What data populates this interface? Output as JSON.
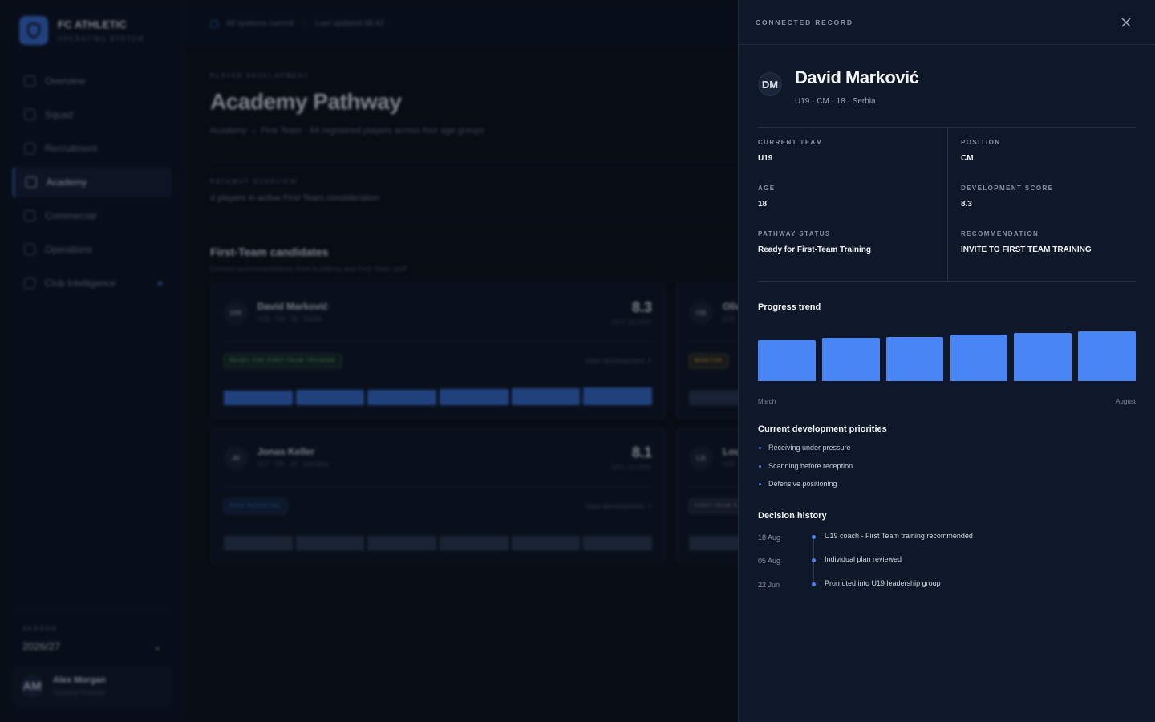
{
  "brand": {
    "name": "FC ATHLETIC",
    "subtitle": "OPERATING SYSTEM"
  },
  "nav": [
    {
      "label": "Overview",
      "icon": "grid-icon",
      "active": false
    },
    {
      "label": "Squad",
      "icon": "users-icon",
      "active": false
    },
    {
      "label": "Recruitment",
      "icon": "globe-icon",
      "active": false
    },
    {
      "label": "Academy",
      "icon": "graduation-cap-icon",
      "active": true
    },
    {
      "label": "Commercial",
      "icon": "briefcase-icon",
      "active": false
    },
    {
      "label": "Operations",
      "icon": "building-icon",
      "active": false
    },
    {
      "label": "Club Intelligence",
      "icon": "brain-icon",
      "active": false,
      "dot": true
    }
  ],
  "season": {
    "label": "SEASON",
    "value": "2026/27"
  },
  "user": {
    "initials": "AM",
    "name": "Alex Morgan",
    "role": "General Director"
  },
  "topbar": {
    "status": "All systems current",
    "updated": "Last updated 08:42"
  },
  "main": {
    "eyebrow": "PLAYER DEVELOPMENT",
    "title": "Academy Pathway",
    "subtitle": "Academy → First Team · 64 registered players across four age groups",
    "overview_label": "PATHWAY OVERVIEW",
    "overview_text": "4 players in active First Team consideration",
    "section_title": "First-Team candidates",
    "section_subtitle": "Current recommendations from Academy and First Team staff"
  },
  "cards": [
    {
      "initials": "DM",
      "name": "David Marković",
      "meta": "U19 · CM · 18 · Serbia",
      "score": "8.3",
      "score_label": "DEV SCORE",
      "badge": "READY FOR FIRST-TEAM TRAINING",
      "link": "View development ↗",
      "badge_color": "#5fae5a",
      "bars": [
        0.8,
        0.85,
        0.86,
        0.9,
        0.95,
        1.0
      ],
      "bar_color": "#3a6fd8"
    },
    {
      "initials": "JK",
      "name": "Jonas Keller",
      "meta": "U17 · CB · 16 · Germany",
      "score": "8.1",
      "score_label": "DEV SCORE",
      "badge": "HIGH POTENTIAL",
      "link": "View development ↗",
      "badge_color": "#3b73e0",
      "bars": [
        0.8,
        0.8,
        0.8,
        0.8,
        0.8,
        0.8
      ],
      "bar_color": "#2a3a52"
    },
    {
      "initials": "OB",
      "name": "Oliv",
      "meta": "U19",
      "score": "",
      "score_label": "",
      "badge": "MONITOR",
      "link": "",
      "badge_color": "#d59a2e",
      "bars": [
        0.8
      ],
      "bar_color": "#2a3a52"
    },
    {
      "initials": "LB",
      "name": "Lou",
      "meta": "U19",
      "score": "",
      "score_label": "",
      "badge": "FIRST-TEAM R",
      "link": "",
      "badge_color": "#8793a6",
      "bars": [
        0.8
      ],
      "bar_color": "#2a3a52"
    }
  ],
  "panel": {
    "eyebrow": "CONNECTED RECORD",
    "initials": "DM",
    "name": "David Marković",
    "meta": "U19 · CM · 18 · Serbia",
    "stats_left": [
      {
        "label": "CURRENT TEAM",
        "value": "U19"
      },
      {
        "label": "AGE",
        "value": "18"
      },
      {
        "label": "PATHWAY STATUS",
        "value": "Ready for First-Team Training"
      }
    ],
    "stats_right": [
      {
        "label": "POSITION",
        "value": "CM"
      },
      {
        "label": "DEVELOPMENT SCORE",
        "value": "8.3"
      },
      {
        "label": "RECOMMENDATION",
        "value": "INVITE TO FIRST TEAM TRAINING"
      }
    ],
    "trend_title": "Progress trend",
    "priorities_title": "Current development priorities",
    "priorities": [
      "Receiving under pressure",
      "Scanning before reception",
      "Defensive positioning"
    ],
    "history_title": "Decision history",
    "history": [
      {
        "date": "18 Aug",
        "text": "U19 coach - First Team training recommended"
      },
      {
        "date": "05 Aug",
        "text": "Individual plan reviewed"
      },
      {
        "date": "22 Jun",
        "text": "Promoted into U19 leadership group"
      }
    ],
    "accent": "#4a85f5"
  },
  "chart_data": {
    "type": "bar",
    "categories": [
      "March",
      "",
      "",
      "",
      "",
      "August"
    ],
    "values": [
      66,
      69,
      71,
      75,
      77,
      79
    ],
    "ylim": [
      0,
      100
    ],
    "x_tick_labels": [
      "March",
      "August"
    ],
    "grid": false,
    "legend": "none"
  }
}
